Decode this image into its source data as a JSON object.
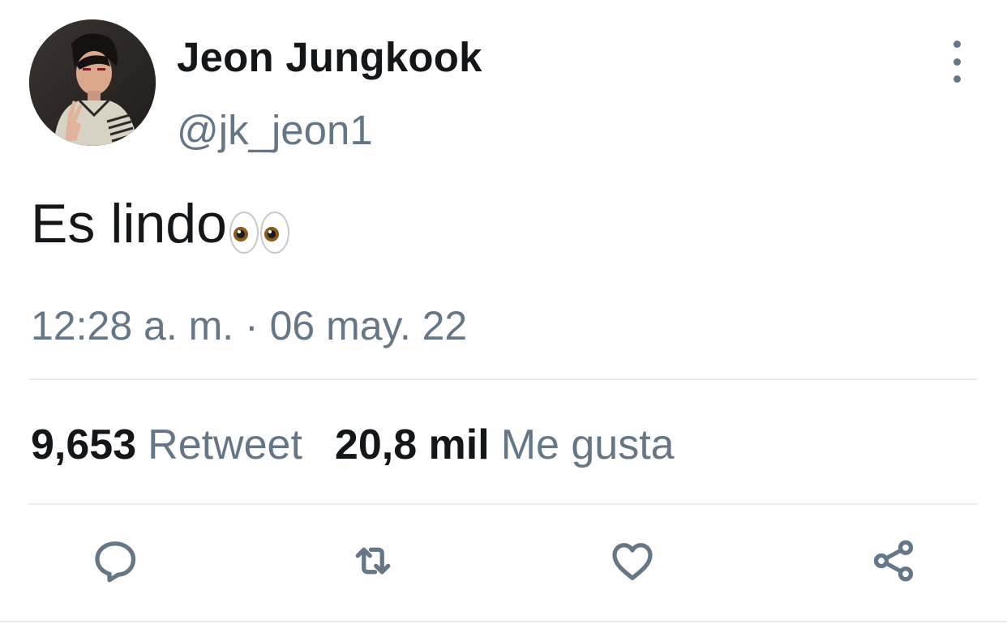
{
  "tweet": {
    "author": {
      "display_name": "Jeon Jungkook",
      "handle": "@jk_jeon1"
    },
    "text": "Es lindo",
    "emoji_icon": "eyes-emoji-icon",
    "timestamp": "12:28 a. m. · 06 may. 22",
    "stats": {
      "retweets_count": "9,653",
      "retweets_label": "Retweet",
      "likes_count": "20,8 mil",
      "likes_label": "Me gusta"
    },
    "actions": [
      "reply-icon",
      "retweet-icon",
      "like-icon",
      "share-icon"
    ]
  },
  "colors": {
    "text_primary": "#14171a",
    "text_secondary": "#657786",
    "divider": "#e6ecf0",
    "background": "#ffffff"
  }
}
